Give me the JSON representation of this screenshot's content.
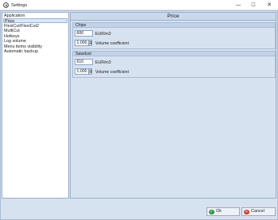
{
  "window": {
    "title": "Settings",
    "controls": {
      "minimize": "—",
      "maximize": "☐",
      "close": "✕"
    }
  },
  "nav": {
    "items": [
      {
        "label": "Application",
        "selected": false
      },
      {
        "label": "Price",
        "selected": true
      },
      {
        "label": "FlexiCut/FlexiCut2",
        "selected": false
      },
      {
        "label": "MultiCut",
        "selected": false
      },
      {
        "label": "Hotkeys",
        "selected": false
      },
      {
        "label": "Log volume",
        "selected": false
      },
      {
        "label": "Menu items visibility",
        "selected": false
      },
      {
        "label": "Automatic backup",
        "selected": false
      }
    ]
  },
  "content": {
    "header": "Price",
    "groups": [
      {
        "title": "Chips",
        "price_value": "600",
        "price_unit": "EUR/m3",
        "coefficient_value": "1.000",
        "coefficient_label": "Volume coefficient"
      },
      {
        "title": "Sawdust",
        "price_value": "610",
        "price_unit": "EUR/m3",
        "coefficient_value": "1.000",
        "coefficient_label": "Volume coefficient"
      }
    ]
  },
  "footer": {
    "ok_label": "Ok",
    "cancel_label": "Cancel",
    "ok_icon": "check-icon",
    "cancel_icon": "cross-icon"
  },
  "colors": {
    "panel_background": "#d7e2f0",
    "header_background": "#cad8eb",
    "group_title_background": "#c2d2e8",
    "border": "#9aaec8",
    "selected_item": "#dde7f5",
    "ok_icon": "#2f9a3c",
    "cancel_icon": "#d23a2f"
  }
}
